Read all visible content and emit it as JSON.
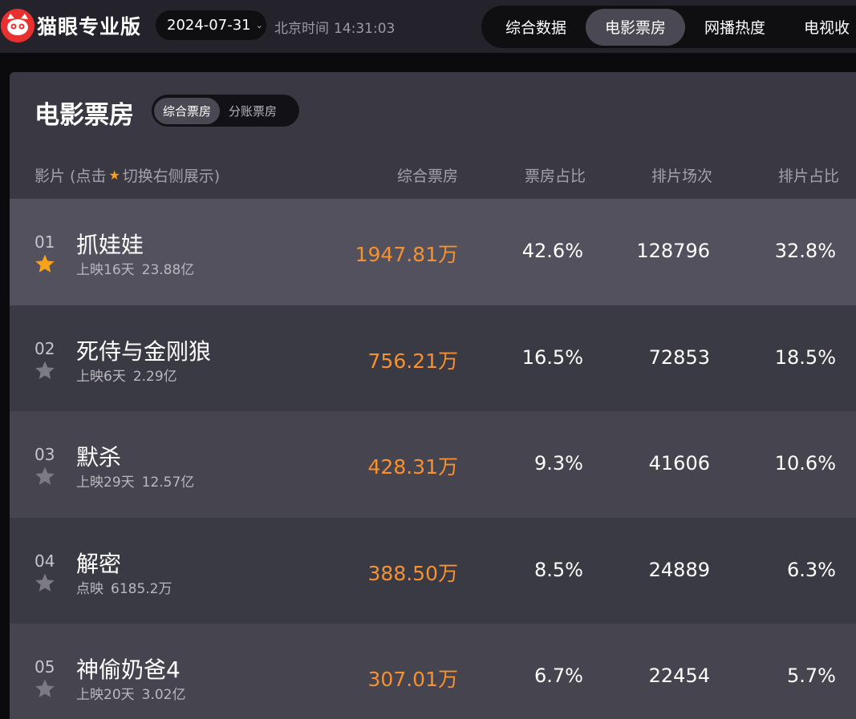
{
  "brand": {
    "name": "猫眼专业版",
    "logo_color": "#e8312f"
  },
  "header": {
    "date": "2024-07-31",
    "date_chevron": "⌄",
    "beijing_time_label": "北京时间",
    "beijing_time": "14:31:03"
  },
  "nav": {
    "items": [
      {
        "label": "综合数据"
      },
      {
        "label": "电影票房",
        "active": true
      },
      {
        "label": "网播热度"
      },
      {
        "label": "电视收"
      }
    ]
  },
  "panel": {
    "title": "电影票房",
    "segments": [
      {
        "label": "综合票房",
        "active": true
      },
      {
        "label": "分账票房"
      }
    ],
    "columns": {
      "film_prefix": "影片 (点击",
      "film_suffix": "切换右侧展示)",
      "box_office": "综合票房",
      "box_ratio": "票房占比",
      "shows": "排片场次",
      "show_ratio": "排片占比"
    }
  },
  "rows": [
    {
      "rank": "01",
      "name": "抓娃娃",
      "days": "上映16天",
      "total": "23.88亿",
      "box": "1947.81万",
      "box_ratio": "42.6%",
      "shows": "128796",
      "show_ratio": "32.8%",
      "starred": true
    },
    {
      "rank": "02",
      "name": "死侍与金刚狼",
      "days": "上映6天",
      "total": "2.29亿",
      "box": "756.21万",
      "box_ratio": "16.5%",
      "shows": "72853",
      "show_ratio": "18.5%",
      "starred": false
    },
    {
      "rank": "03",
      "name": "默杀",
      "days": "上映29天",
      "total": "12.57亿",
      "box": "428.31万",
      "box_ratio": "9.3%",
      "shows": "41606",
      "show_ratio": "10.6%",
      "starred": false
    },
    {
      "rank": "04",
      "name": "解密",
      "days": "点映",
      "total": "6185.2万",
      "box": "388.50万",
      "box_ratio": "8.5%",
      "shows": "24889",
      "show_ratio": "6.3%",
      "starred": false
    },
    {
      "rank": "05",
      "name": "神偷奶爸4",
      "days": "上映20天",
      "total": "3.02亿",
      "box": "307.01万",
      "box_ratio": "6.7%",
      "shows": "22454",
      "show_ratio": "5.7%",
      "starred": false
    }
  ],
  "colors": {
    "accent_orange": "#f7902f",
    "star_active": "#f7a21b",
    "star_inactive": "#7c7b84"
  },
  "icons": {
    "star": "star-icon",
    "logo": "cat-logo-icon",
    "chevron": "chevron-down-icon"
  }
}
